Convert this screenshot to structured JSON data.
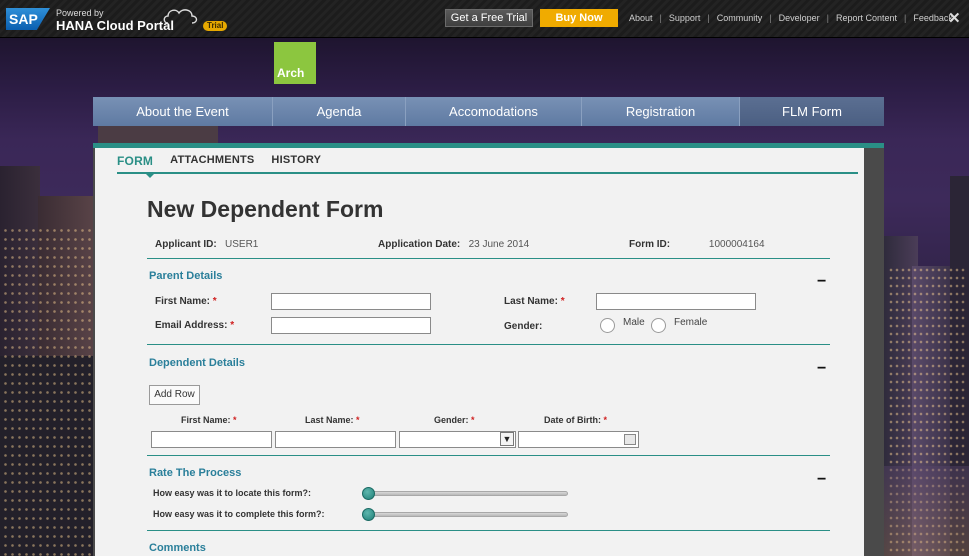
{
  "topbar": {
    "sap_logo": "SAP",
    "powered_by": "Powered by",
    "product": "HANA Cloud Portal",
    "trial_badge": "Trial",
    "free_trial_label": "Get a Free Trial",
    "buy_now_label": "Buy Now",
    "links": [
      "About",
      "Support",
      "Community",
      "Developer",
      "Report Content",
      "Feedback"
    ],
    "close_icon": "close-icon"
  },
  "site": {
    "logo_text": "Arch"
  },
  "nav": {
    "items": [
      "About the Event",
      "Agenda",
      "Accomodations",
      "Registration",
      "FLM Form"
    ],
    "active": "FLM Form"
  },
  "tabs": {
    "items": [
      "FORM",
      "ATTACHMENTS",
      "HISTORY"
    ],
    "active": "FORM"
  },
  "form": {
    "title": "New Dependent Form",
    "applicant_id_label": "Applicant ID:",
    "applicant_id": "USER1",
    "application_date_label": "Application Date:",
    "application_date": "23 June 2014",
    "form_id_label": "Form ID:",
    "form_id": "1000004164"
  },
  "parent_details": {
    "title": "Parent Details",
    "first_name_label": "First Name:",
    "last_name_label": "Last Name:",
    "email_label": "Email Address:",
    "gender_label": "Gender:",
    "gender_options": [
      "Male",
      "Female"
    ],
    "required_mark": "*",
    "collapse": "−"
  },
  "dependent_details": {
    "title": "Dependent Details",
    "add_row_label": "Add Row",
    "columns": [
      "First Name:",
      "Last Name:",
      "Gender:",
      "Date of Birth:"
    ],
    "collapse": "−"
  },
  "rate_process": {
    "title": "Rate The Process",
    "questions": [
      "How easy was it to locate this form?:",
      "How easy was it to complete this form?:"
    ],
    "slider_values": [
      0,
      0
    ],
    "collapse": "−"
  },
  "comments": {
    "title": "Comments"
  },
  "colors": {
    "accent": "#2a8f86",
    "buy_now": "#f0ab00",
    "nav": "#6b85ac",
    "logo": "#8cc63f"
  }
}
